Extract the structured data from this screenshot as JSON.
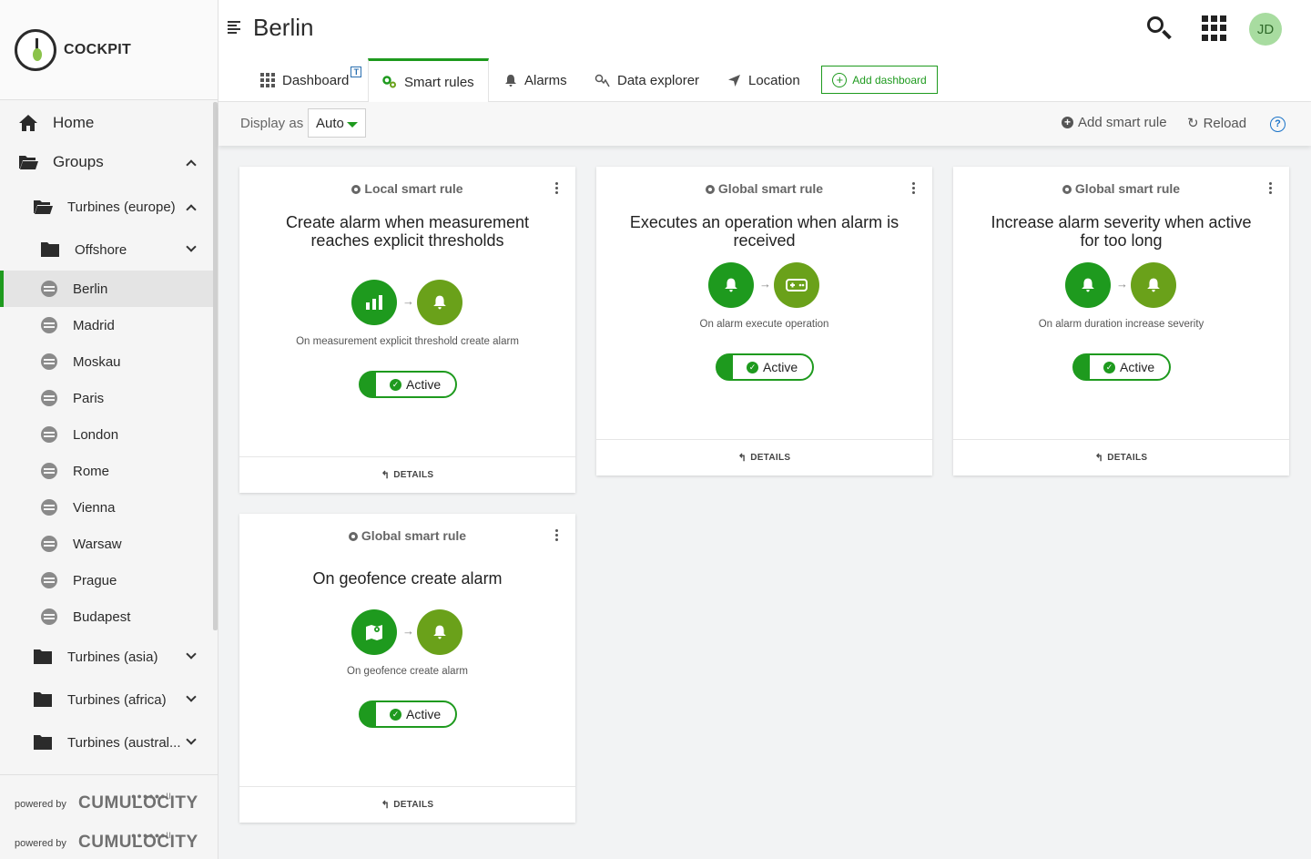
{
  "app": {
    "name": "COCKPIT"
  },
  "header": {
    "title": "Berlin",
    "avatar_initials": "JD"
  },
  "sidebar": {
    "home": "Home",
    "groups": "Groups",
    "turbines_europe": "Turbines (europe)",
    "offshore": "Offshore",
    "devices": [
      "Berlin",
      "Madrid",
      "Moskau",
      "Paris",
      "London",
      "Rome",
      "Vienna",
      "Warsaw",
      "Prague",
      "Budapest"
    ],
    "turbines_asia": "Turbines (asia)",
    "turbines_africa": "Turbines (africa)",
    "turbines_australia": "Turbines (austral...",
    "powered_by": "powered by",
    "cumulocity": "CUMULOCITY"
  },
  "tabs": {
    "dashboard": "Dashboard",
    "dashboard_badge": "T",
    "smart_rules": "Smart rules",
    "alarms": "Alarms",
    "data_explorer": "Data explorer",
    "location": "Location",
    "add_dashboard": "Add dashboard"
  },
  "toolbar": {
    "display_as_label": "Display as",
    "display_as_value": "Auto",
    "add_smart_rule": "Add smart rule",
    "reload": "Reload",
    "help": "?"
  },
  "cards": [
    {
      "type": "Local smart rule",
      "title": "Create alarm when measurement reaches explicit thresholds",
      "desc": "On measurement explicit threshold create alarm",
      "status": "Active",
      "details": "DETAILS"
    },
    {
      "type": "Global smart rule",
      "title": "Executes an operation when alarm is received",
      "desc": "On alarm execute operation",
      "status": "Active",
      "details": "DETAILS"
    },
    {
      "type": "Global smart rule",
      "title": "Increase alarm severity when active for too long",
      "desc": "On alarm duration increase severity",
      "status": "Active",
      "details": "DETAILS"
    },
    {
      "type": "Global smart rule",
      "title": "On geofence create alarm",
      "desc": "On geofence create alarm",
      "status": "Active",
      "details": "DETAILS"
    }
  ],
  "colors": {
    "primary": "#1e9a1e",
    "secondary": "#6aa11a",
    "link": "#1a73c8"
  }
}
